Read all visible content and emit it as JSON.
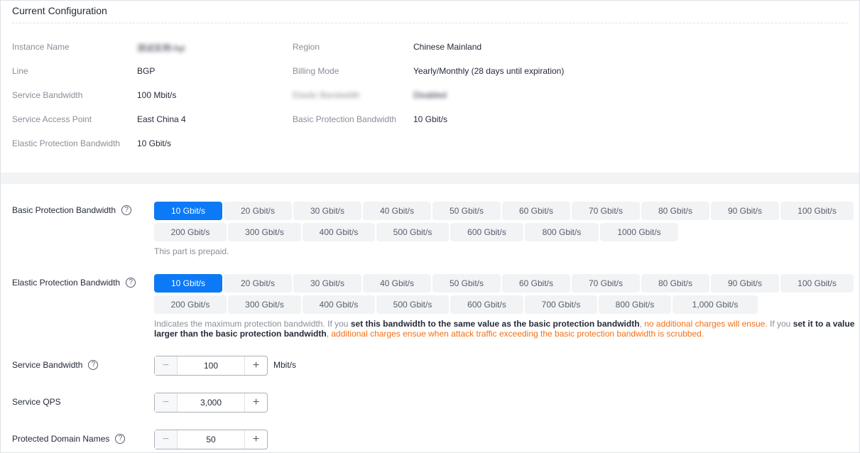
{
  "current": {
    "title": "Current Configuration",
    "fields": {
      "instance_name_label": "Instance Name",
      "instance_name_value": "测试实例-hyi",
      "region_label": "Region",
      "region_value": "Chinese Mainland",
      "line_label": "Line",
      "line_value": "BGP",
      "billing_label": "Billing Mode",
      "billing_value": "Yearly/Monthly (28 days until expiration)",
      "service_bw_label": "Service Bandwidth",
      "service_bw_value": "100 Mbit/s",
      "elastic_bw_label": "Elastic Bandwidth",
      "elastic_bw_value": "Disabled",
      "sap_label": "Service Access Point",
      "sap_value": "East China 4",
      "basic_pb_label": "Basic Protection Bandwidth",
      "basic_pb_value": "10 Gbit/s",
      "elastic_pb_label": "Elastic Protection Bandwidth",
      "elastic_pb_value": "10 Gbit/s"
    }
  },
  "basic": {
    "label": "Basic Protection Bandwidth",
    "help": "?",
    "options_row1": [
      "10 Gbit/s",
      "20 Gbit/s",
      "30 Gbit/s",
      "40 Gbit/s",
      "50 Gbit/s",
      "60 Gbit/s",
      "70 Gbit/s",
      "80 Gbit/s",
      "90 Gbit/s",
      "100 Gbit/s"
    ],
    "options_row2": [
      "200 Gbit/s",
      "300 Gbit/s",
      "400 Gbit/s",
      "500 Gbit/s",
      "600 Gbit/s",
      "800 Gbit/s",
      "1000 Gbit/s"
    ],
    "selected": "10 Gbit/s",
    "note": "This part is prepaid."
  },
  "elastic": {
    "label": "Elastic Protection Bandwidth",
    "help": "?",
    "options_row1": [
      "10 Gbit/s",
      "20 Gbit/s",
      "30 Gbit/s",
      "40 Gbit/s",
      "50 Gbit/s",
      "60 Gbit/s",
      "70 Gbit/s",
      "80 Gbit/s",
      "90 Gbit/s",
      "100 Gbit/s"
    ],
    "options_row2": [
      "200 Gbit/s",
      "300 Gbit/s",
      "400 Gbit/s",
      "500 Gbit/s",
      "600 Gbit/s",
      "700 Gbit/s",
      "800 Gbit/s",
      "1,000 Gbit/s"
    ],
    "selected": "10 Gbit/s",
    "desc_1": "Indicates the maximum protection bandwidth. If you ",
    "desc_2": "set this bandwidth to the same value as the basic protection bandwidth",
    "desc_3": ", ",
    "desc_4": "no additional charges will ensue.",
    "desc_5": " If you ",
    "desc_6": "set it to a value larger than the basic protection bandwidth",
    "desc_7": ", ",
    "desc_8": "additional charges ensue when attack traffic exceeding the basic protection bandwidth is scrubbed."
  },
  "service_bw": {
    "label": "Service Bandwidth",
    "help": "?",
    "value": "100",
    "unit": "Mbit/s",
    "minus": "−",
    "plus": "+"
  },
  "service_qps": {
    "label": "Service QPS",
    "value": "3,000",
    "minus": "−",
    "plus": "+"
  },
  "domains": {
    "label": "Protected Domain Names",
    "help": "?",
    "value": "50",
    "minus": "−",
    "plus": "+"
  }
}
